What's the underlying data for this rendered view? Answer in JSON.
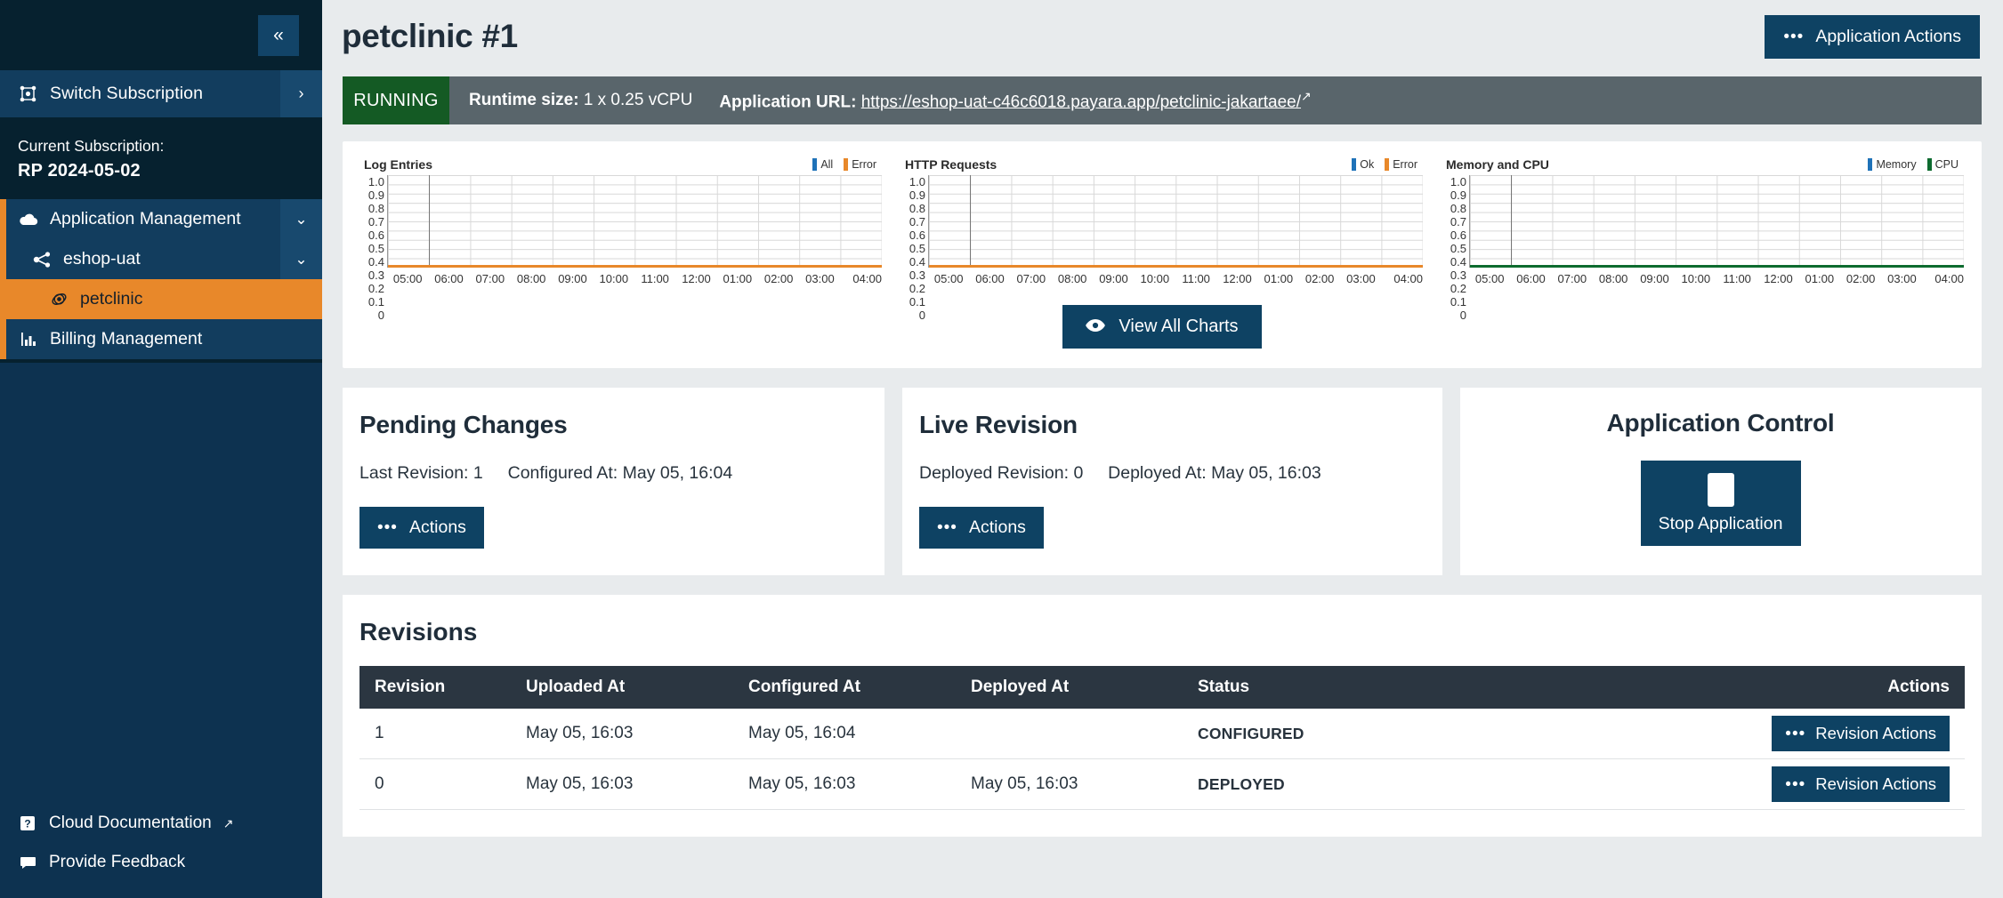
{
  "sidebar": {
    "collapse_label": "«",
    "switch_subscription": {
      "label": "Switch Subscription",
      "icon": "subscription-icon",
      "chevron": "›"
    },
    "current_subscription": {
      "caption": "Current Subscription:",
      "value": "RP 2024-05-02"
    },
    "nav": [
      {
        "label": "Application Management",
        "icon": "cloud-icon",
        "chevron": "⌄",
        "level": 0
      },
      {
        "label": "eshop-uat",
        "icon": "share-nodes-icon",
        "chevron": "⌄",
        "level": 1
      },
      {
        "label": "petclinic",
        "icon": "atom-icon",
        "level": 2,
        "active": true
      },
      {
        "label": "Billing Management",
        "icon": "bar-chart-icon",
        "level": 0
      }
    ],
    "footer": [
      {
        "label": "Cloud Documentation",
        "icon": "help-icon",
        "external": "↗"
      },
      {
        "label": "Provide Feedback",
        "icon": "comment-icon"
      }
    ]
  },
  "header": {
    "title": "petclinic #1",
    "application_actions_label": "Application Actions",
    "dots_icon": "ellipsis-icon"
  },
  "status": {
    "state": "RUNNING",
    "runtime_label": "Runtime size:",
    "runtime_value": "1 x 0.25 vCPU",
    "url_label": "Application URL:",
    "url_text": "https://eshop-uat-c46c6018.payara.app/petclinic-jakartaee/",
    "external_icon": "↗"
  },
  "charts": {
    "view_all_label": "View All Charts",
    "eye_icon": "eye-icon"
  },
  "chart_data": [
    {
      "type": "line",
      "title": "Log Entries",
      "xlabel": "",
      "ylabel": "",
      "ylim": [
        0,
        1.0
      ],
      "yticks": [
        "1.0",
        "0.9",
        "0.8",
        "0.7",
        "0.6",
        "0.5",
        "0.4",
        "0.3",
        "0.2",
        "0.1",
        "0"
      ],
      "xticks": [
        "05:00",
        "06:00",
        "07:00",
        "08:00",
        "09:00",
        "10:00",
        "11:00",
        "12:00",
        "01:00",
        "02:00",
        "03:00",
        "04:00"
      ],
      "grid": true,
      "legend_position": "top-right",
      "series": [
        {
          "name": "All",
          "color": "#1f72b8",
          "values": [
            0,
            0,
            0,
            0,
            0,
            0,
            0,
            0,
            0,
            0,
            0,
            0
          ]
        },
        {
          "name": "Error",
          "color": "#e8882a",
          "values": [
            0,
            0,
            0,
            0,
            0,
            0,
            0,
            0,
            0,
            0,
            0,
            0
          ]
        }
      ]
    },
    {
      "type": "line",
      "title": "HTTP Requests",
      "xlabel": "",
      "ylabel": "",
      "ylim": [
        0,
        1.0
      ],
      "yticks": [
        "1.0",
        "0.9",
        "0.8",
        "0.7",
        "0.6",
        "0.5",
        "0.4",
        "0.3",
        "0.2",
        "0.1",
        "0"
      ],
      "xticks": [
        "05:00",
        "06:00",
        "07:00",
        "08:00",
        "09:00",
        "10:00",
        "11:00",
        "12:00",
        "01:00",
        "02:00",
        "03:00",
        "04:00"
      ],
      "grid": true,
      "legend_position": "top-right",
      "series": [
        {
          "name": "Ok",
          "color": "#1f72b8",
          "values": [
            0,
            0,
            0,
            0,
            0,
            0,
            0,
            0,
            0,
            0,
            0,
            0
          ]
        },
        {
          "name": "Error",
          "color": "#e8882a",
          "values": [
            0,
            0,
            0,
            0,
            0,
            0,
            0,
            0,
            0,
            0,
            0,
            0
          ]
        }
      ]
    },
    {
      "type": "line",
      "title": "Memory and CPU",
      "xlabel": "",
      "ylabel": "",
      "ylim": [
        0,
        1.0
      ],
      "yticks": [
        "1.0",
        "0.9",
        "0.8",
        "0.7",
        "0.6",
        "0.5",
        "0.4",
        "0.3",
        "0.2",
        "0.1",
        "0"
      ],
      "xticks": [
        "05:00",
        "06:00",
        "07:00",
        "08:00",
        "09:00",
        "10:00",
        "11:00",
        "12:00",
        "01:00",
        "02:00",
        "03:00",
        "04:00"
      ],
      "grid": true,
      "legend_position": "top-right",
      "series": [
        {
          "name": "Memory",
          "color": "#1f72b8",
          "values": [
            0,
            0,
            0,
            0,
            0,
            0,
            0,
            0,
            0,
            0,
            0,
            0
          ]
        },
        {
          "name": "CPU",
          "color": "#0d6b2f",
          "values": [
            0,
            0,
            0,
            0,
            0,
            0,
            0,
            0,
            0,
            0,
            0,
            0
          ]
        }
      ]
    }
  ],
  "pending_changes": {
    "title": "Pending Changes",
    "last_revision_label": "Last Revision:",
    "last_revision_value": "1",
    "configured_at_label": "Configured At:",
    "configured_at_value": "May 05, 16:04",
    "actions_label": "Actions"
  },
  "live_revision": {
    "title": "Live Revision",
    "deployed_revision_label": "Deployed Revision:",
    "deployed_revision_value": "0",
    "deployed_at_label": "Deployed At:",
    "deployed_at_value": "May 05, 16:03",
    "actions_label": "Actions"
  },
  "application_control": {
    "title": "Application Control",
    "stop_label": "Stop Application",
    "stop_icon": "stop-square-icon"
  },
  "revisions": {
    "title": "Revisions",
    "columns": [
      "Revision",
      "Uploaded At",
      "Configured At",
      "Deployed At",
      "Status",
      "Actions"
    ],
    "action_label": "Revision Actions",
    "rows": [
      {
        "revision": "1",
        "uploaded_at": "May 05, 16:03",
        "configured_at": "May 05, 16:04",
        "deployed_at": "",
        "status": "CONFIGURED"
      },
      {
        "revision": "0",
        "uploaded_at": "May 05, 16:03",
        "configured_at": "May 05, 16:03",
        "deployed_at": "May 05, 16:03",
        "status": "DEPLOYED"
      }
    ]
  },
  "colors": {
    "sidebar_bg": "#0d3250",
    "sidebar_dark": "#06212f",
    "accent_orange": "#e8882a",
    "button_navy": "#0e4263",
    "running_green": "#145a24",
    "statusbar_gray": "#59656b",
    "table_header": "#2b3641"
  }
}
